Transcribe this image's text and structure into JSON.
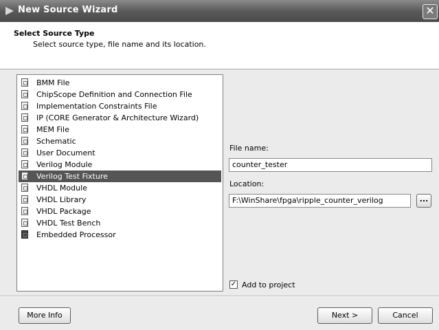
{
  "window": {
    "title": "New Source Wizard",
    "close_glyph": "✕"
  },
  "header": {
    "title": "Select Source Type",
    "subtitle": "Select source type, file name and its location."
  },
  "source_types": [
    {
      "label": "BMM File",
      "icon": "bmm-file-icon",
      "selected": false
    },
    {
      "label": "ChipScope Definition and Connection File",
      "icon": "chipscope-icon",
      "selected": false
    },
    {
      "label": "Implementation Constraints File",
      "icon": "constraints-file-icon",
      "selected": false
    },
    {
      "label": "IP (CORE Generator & Architecture Wizard)",
      "icon": "ip-core-icon",
      "selected": false
    },
    {
      "label": "MEM File",
      "icon": "mem-file-icon",
      "selected": false
    },
    {
      "label": "Schematic",
      "icon": "schematic-icon",
      "selected": false
    },
    {
      "label": "User Document",
      "icon": "document-icon",
      "selected": false
    },
    {
      "label": "Verilog Module",
      "icon": "verilog-module-icon",
      "selected": false
    },
    {
      "label": "Verilog Test Fixture",
      "icon": "verilog-test-fixture-icon",
      "selected": true
    },
    {
      "label": "VHDL Module",
      "icon": "vhdl-module-icon",
      "selected": false
    },
    {
      "label": "VHDL Library",
      "icon": "vhdl-library-icon",
      "selected": false
    },
    {
      "label": "VHDL Package",
      "icon": "vhdl-package-icon",
      "selected": false
    },
    {
      "label": "VHDL Test Bench",
      "icon": "vhdl-test-bench-icon",
      "selected": false
    },
    {
      "label": "Embedded Processor",
      "icon": "embedded-processor-icon",
      "selected": false
    }
  ],
  "form": {
    "file_name_label": "File name:",
    "file_name_value": "counter_tester",
    "location_label": "Location:",
    "location_value": "F:\\WinShare\\fpga\\ripple_counter_verilog",
    "browse_label": "...",
    "add_to_project_label": "Add to project",
    "add_to_project_checked": true,
    "check_glyph": "✓"
  },
  "buttons": {
    "more_info": "More Info",
    "next": "Next >",
    "cancel": "Cancel"
  }
}
